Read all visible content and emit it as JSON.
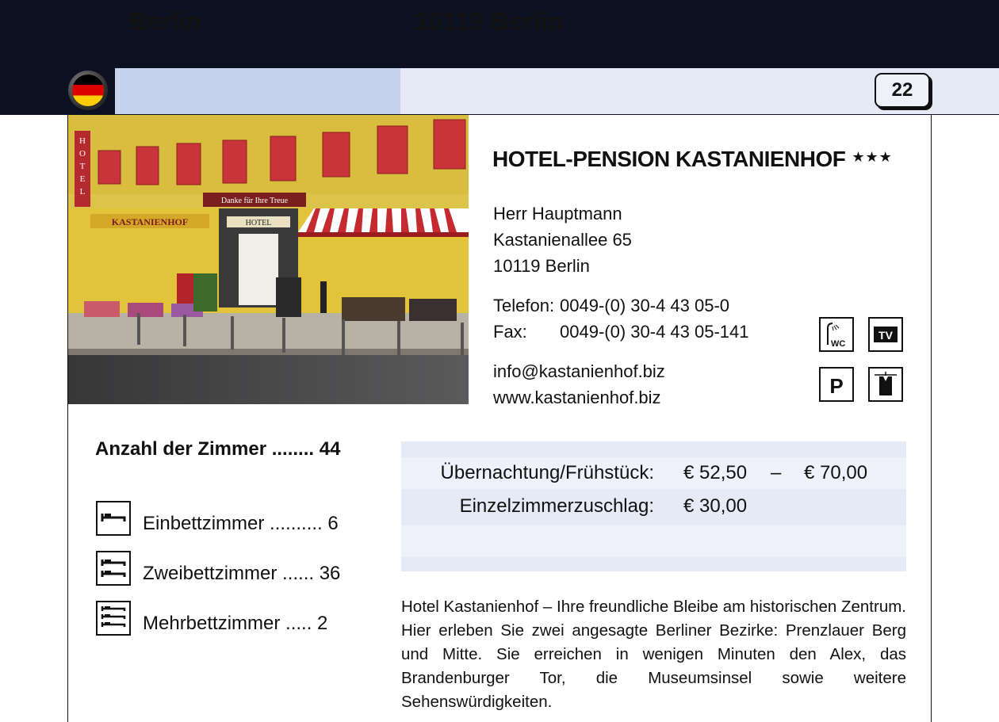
{
  "header": {
    "city": "Berlin",
    "zip_city": "10119 Berlin",
    "page_number": "22",
    "flag_icon": "germany-flag-icon"
  },
  "hotel": {
    "name": "HOTEL-PENSION KASTANIENHOF",
    "stars": "★★★",
    "contact_person": "Herr Hauptmann",
    "street": "Kastanienallee 65",
    "city_line": "10119 Berlin",
    "phone_label": "Telefon:",
    "phone": "0049-(0) 30-4 43 05-0",
    "fax_label": "Fax:",
    "fax": "0049-(0) 30-4 43 05-141",
    "email": "info@kastanienhof.biz",
    "website": "www.kastanienhof.biz"
  },
  "amenities": [
    {
      "icon": "shower-wc-icon",
      "label": "WC"
    },
    {
      "icon": "tv-icon",
      "label": "TV"
    },
    {
      "icon": "parking-icon",
      "label": "P"
    },
    {
      "icon": "wardrobe-icon",
      "label": ""
    }
  ],
  "rooms": {
    "title": "Anzahl der Zimmer ........ 44",
    "items": [
      {
        "icon": "single-bed-icon",
        "label": "Einbettzimmer .......... 6"
      },
      {
        "icon": "double-bed-icon",
        "label": "Zweibettzimmer ...... 36"
      },
      {
        "icon": "multi-bed-icon",
        "label": "Mehrbettzimmer ..... 2"
      }
    ]
  },
  "prices": {
    "overnight_label": "Übernachtung/Frühstück:",
    "overnight_from": "€  52,50",
    "dash": "–",
    "overnight_to": "€  70,00",
    "single_label": "Einzelzimmerzuschlag:",
    "single_value": "€  30,00"
  },
  "description": "Hotel Kastanienhof – Ihre freundliche Bleibe am historischen Zentrum. Hier erleben Sie zwei angesagte Berliner Bezirke: Prenzlauer Berg und Mitte. Sie erreichen in wenigen Minuten den Alex, das Brandenburger Tor, die Museumsinsel sowie weitere Sehenswürdigkeiten.",
  "photo_sign": {
    "vertical": "HOTEL",
    "facade": "KASTANIENHOF",
    "banner": "Danke für Ihre Treue",
    "door": "HOTEL"
  },
  "colors": {
    "top_bar": "#0b1120",
    "city_band": "#c7d3ec",
    "zip_band": "#e5eaf6",
    "price_band_dark": "#e5eaf6",
    "price_band_light": "#eef1f9"
  }
}
